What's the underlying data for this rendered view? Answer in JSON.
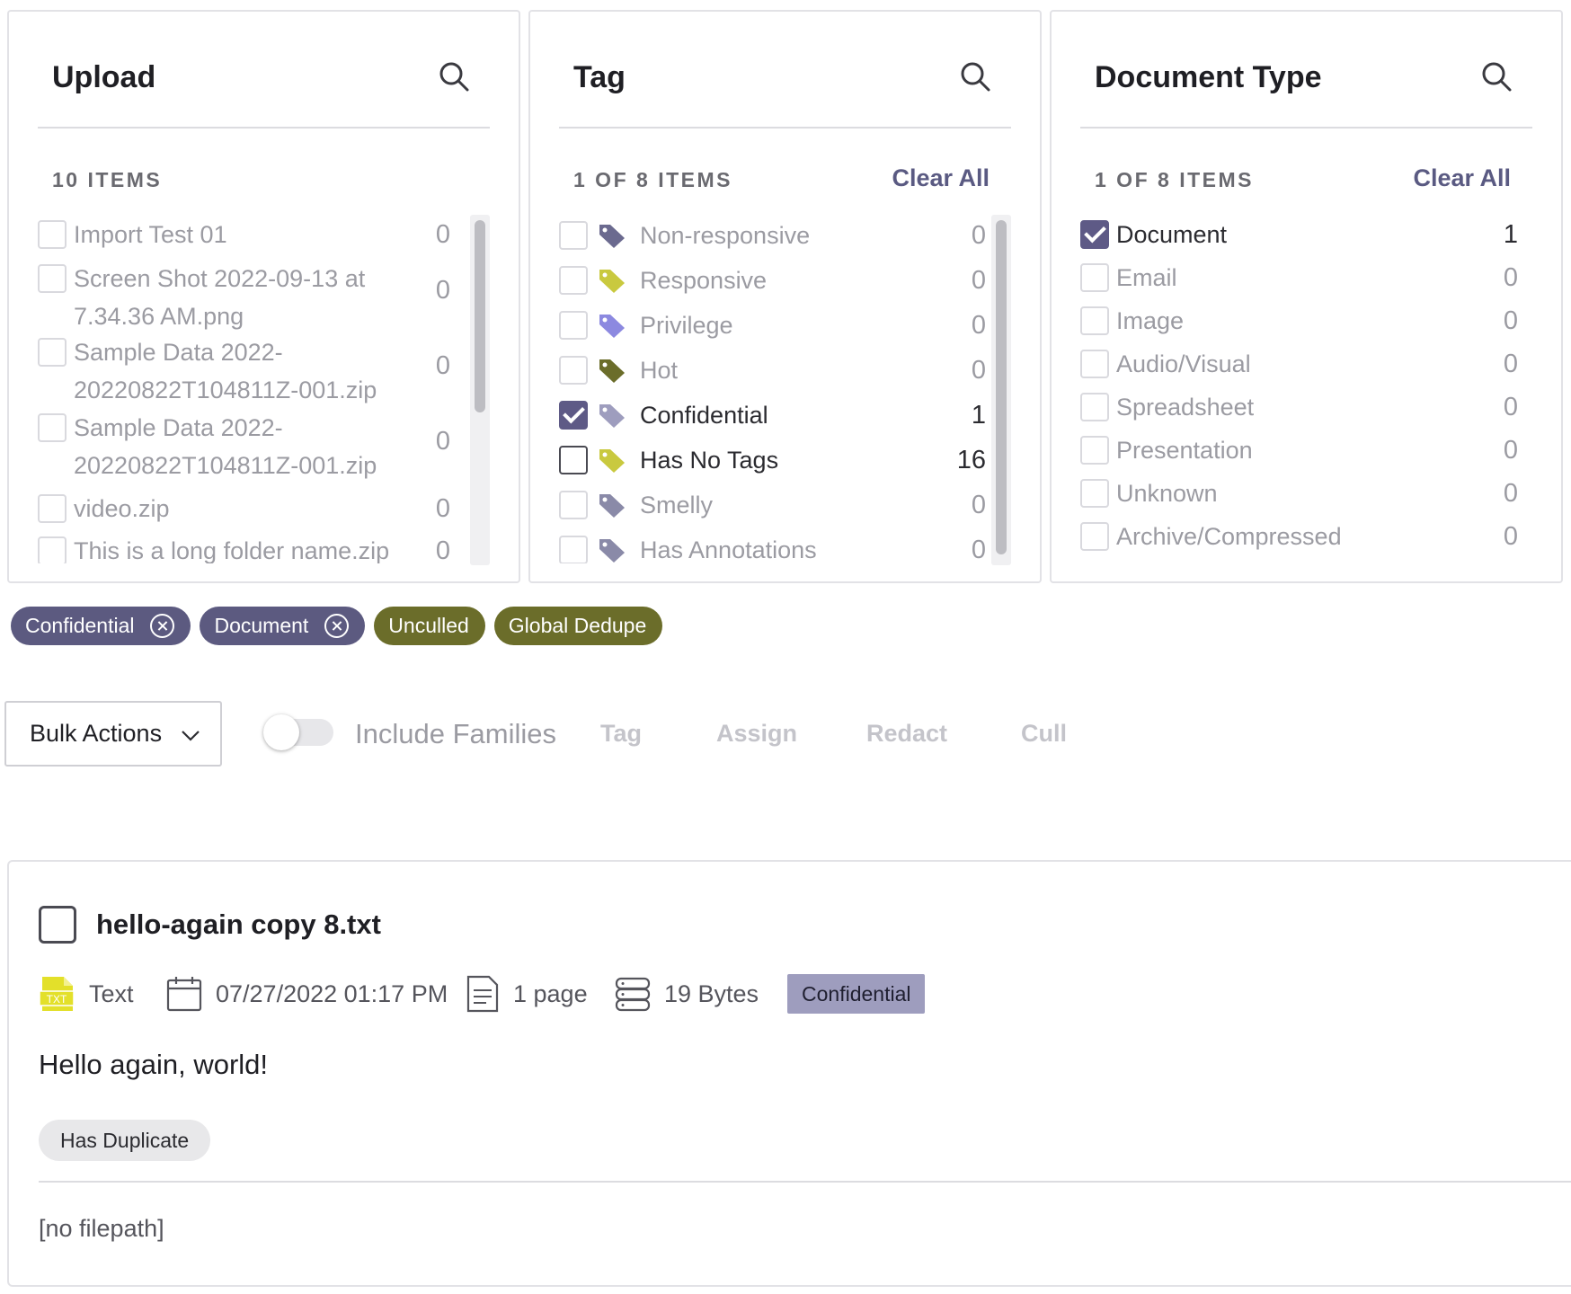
{
  "upload_panel": {
    "title": "Upload",
    "count_label": "10 ITEMS",
    "items": [
      {
        "label": "Import Test 01",
        "count": "0"
      },
      {
        "label": "Screen Shot 2022-09-13 at",
        "label2": "7.34.36 AM.png",
        "count": "0"
      },
      {
        "label": "Sample Data 2022-",
        "label2": "20220822T104811Z-001.zip",
        "count": "0"
      },
      {
        "label": "Sample Data 2022-",
        "label2": "20220822T104811Z-001.zip",
        "count": "0"
      },
      {
        "label": "video.zip",
        "count": "0"
      },
      {
        "label": "This is a long folder name.zip",
        "count": "0"
      }
    ]
  },
  "tag_panel": {
    "title": "Tag",
    "count_label": "1 OF 8 ITEMS",
    "clear_label": "Clear All",
    "items": [
      {
        "label": "Non-responsive",
        "count": "0",
        "color": "#6b6a8f",
        "checked": false
      },
      {
        "label": "Responsive",
        "count": "0",
        "color": "#c9c93f",
        "checked": false
      },
      {
        "label": "Privilege",
        "count": "0",
        "color": "#8c89e0",
        "checked": false
      },
      {
        "label": "Hot",
        "count": "0",
        "color": "#6b6d2a",
        "checked": false
      },
      {
        "label": "Confidential",
        "count": "1",
        "color": "#9e9dbe",
        "checked": true
      },
      {
        "label": "Has No Tags",
        "count": "16",
        "color": "#c9c93f",
        "checked": false
      },
      {
        "label": "Smelly",
        "count": "0",
        "color": "#8a8aa8",
        "checked": false
      },
      {
        "label": "Has Annotations",
        "count": "0",
        "color": "#8a8aa8",
        "checked": false
      }
    ]
  },
  "doctype_panel": {
    "title": "Document Type",
    "count_label": "1 OF 8 ITEMS",
    "clear_label": "Clear All",
    "items": [
      {
        "label": "Document",
        "count": "1",
        "checked": true
      },
      {
        "label": "Email",
        "count": "0",
        "checked": false
      },
      {
        "label": "Image",
        "count": "0",
        "checked": false
      },
      {
        "label": "Audio/Visual",
        "count": "0",
        "checked": false
      },
      {
        "label": "Spreadsheet",
        "count": "0",
        "checked": false
      },
      {
        "label": "Presentation",
        "count": "0",
        "checked": false
      },
      {
        "label": "Unknown",
        "count": "0",
        "checked": false
      },
      {
        "label": "Archive/Compressed",
        "count": "0",
        "checked": false
      }
    ]
  },
  "chips": {
    "confidential": "Confidential",
    "document": "Document",
    "unculled": "Unculled",
    "global_dedupe": "Global Dedupe"
  },
  "toolbar": {
    "bulk_actions": "Bulk Actions",
    "include_families": "Include Families",
    "tag": "Tag",
    "assign": "Assign",
    "redact": "Redact",
    "cull": "Cull"
  },
  "document": {
    "title": "hello-again copy 8.txt",
    "file_icon_text": "TXT",
    "type": "Text",
    "date": "07/27/2022 01:17 PM",
    "pages": "1 page",
    "size": "19 Bytes",
    "tag": "Confidential",
    "snippet": "Hello again, world!",
    "badge": "Has Duplicate",
    "filepath": "[no filepath]"
  },
  "colors": {
    "accent_purple": "#5c5a80",
    "accent_olive": "#6b6d2a",
    "tag_bg": "#9e9dbe",
    "txt_icon_yellow": "#e3e02a"
  }
}
